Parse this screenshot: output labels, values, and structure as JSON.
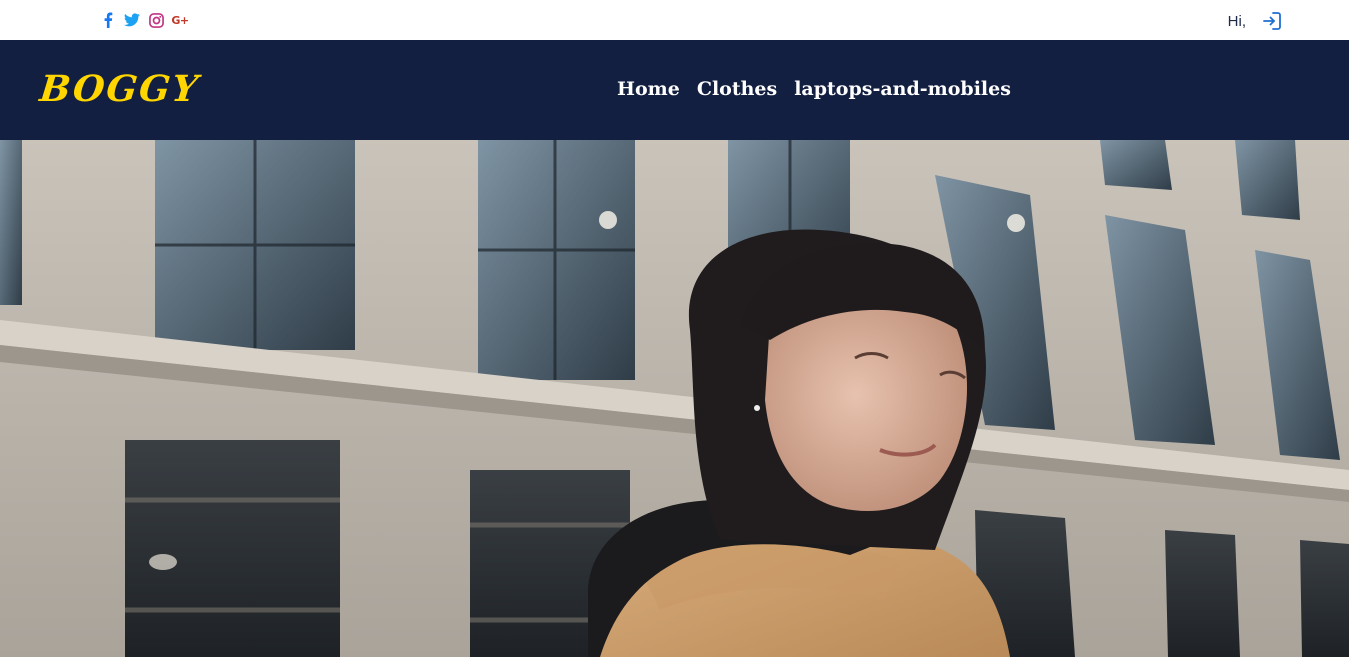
{
  "topbar": {
    "socials": [
      {
        "icon": "facebook-icon",
        "color": "#1877f2"
      },
      {
        "icon": "twitter-icon",
        "color": "#1da1f2"
      },
      {
        "icon": "instagram-icon",
        "color": "#c13584"
      },
      {
        "icon": "google-plus-icon",
        "label": "G+",
        "color": "#c0392b"
      }
    ],
    "greeting": "Hi,",
    "login_icon": "sign-in-icon",
    "login_icon_color": "#1f6fd1"
  },
  "navbar": {
    "brand": "BOGGY",
    "brand_color": "#ffd600",
    "background": "#131f40",
    "links": [
      {
        "label": "Home"
      },
      {
        "label": "Clothes"
      },
      {
        "label": "laptops-and-mobiles"
      }
    ]
  },
  "hero": {
    "image": "hero-photo"
  }
}
